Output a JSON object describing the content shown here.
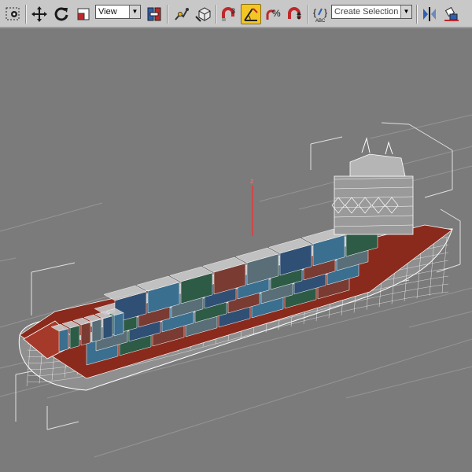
{
  "toolbar": {
    "reference_coordinate_system": "View",
    "named_selection_set_placeholder": "Create Selection Set",
    "icons": [
      "select-object-icon",
      "select-and-move-icon",
      "select-and-rotate-icon",
      "select-and-scale-icon",
      "view-dropdown",
      "use-pivot-center-icon",
      "select-and-link-icon",
      "unlink-selection-icon",
      "snaps-toggle-icon",
      "angle-snap-toggle-icon",
      "percent-snap-icon",
      "spinner-snap-icon",
      "edit-named-selections-icon",
      "named-selection-dropdown",
      "mirror-icon",
      "align-icon"
    ],
    "active_tool": "angle-snap-toggle-icon",
    "accent_color": "#f4c623"
  },
  "viewport": {
    "axis_label": "z",
    "background_color": "#7b7b7b",
    "grid_color": "#959595",
    "wireframe_color": "#ffffff",
    "deck_color": "#8a2a1c",
    "container_colors": [
      "#3b6f8f",
      "#2e5b46",
      "#7a3b33",
      "#5a6e78",
      "#2f4f74"
    ]
  }
}
